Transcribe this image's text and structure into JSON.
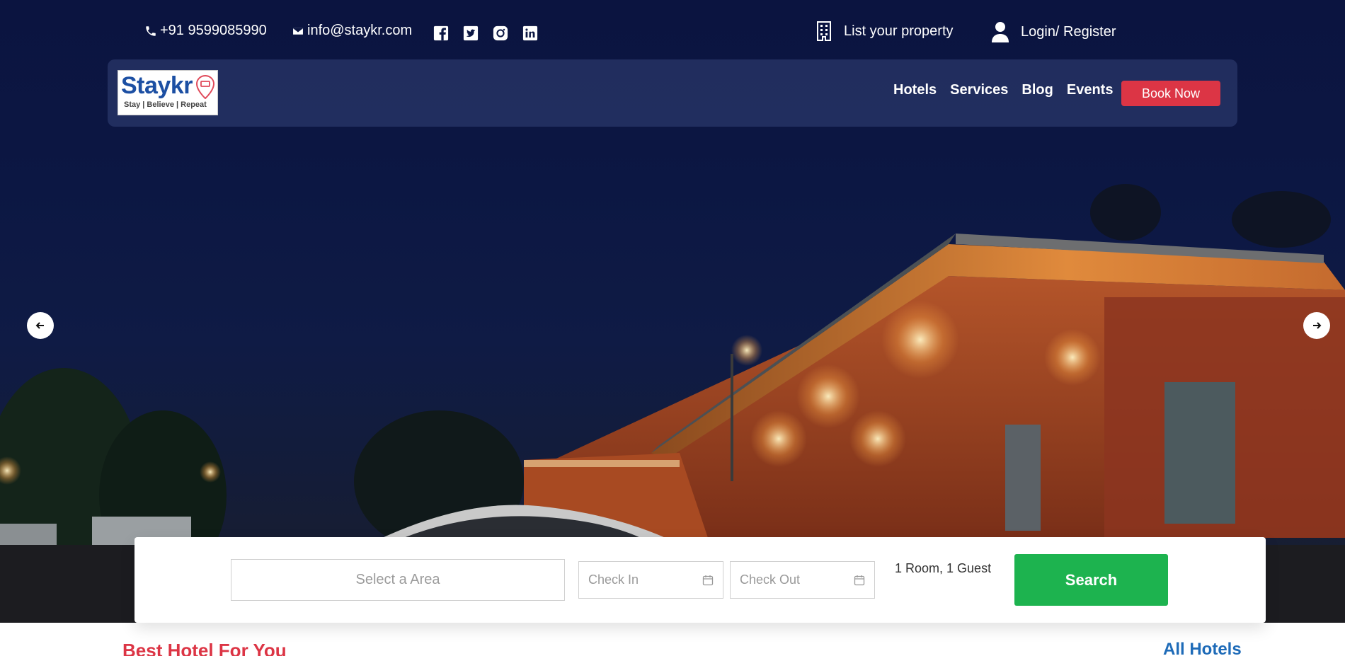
{
  "topbar": {
    "phone": "+91 9599085990",
    "email": "info@staykr.com",
    "social_icons": [
      "facebook-icon",
      "twitter-icon",
      "instagram-icon",
      "linkedin-icon"
    ],
    "list_property_label": "List your property",
    "login_label": "Login/ Register"
  },
  "nav": {
    "logo": {
      "word": "Staykr",
      "tagline": "Stay | Believe | Repeat"
    },
    "links": [
      "Hotels",
      "Services",
      "Blog",
      "Events"
    ],
    "book_now_label": "Book Now"
  },
  "search": {
    "area_placeholder": "Select a Area",
    "check_in_label": "Check In",
    "check_out_label": "Check Out",
    "guests_label": "1 Room, 1 Guest",
    "search_label": "Search"
  },
  "section": {
    "title": "Best Hotel For You",
    "all_hotels_label": "All Hotels"
  },
  "colors": {
    "hero_bg": "#0c1743",
    "accent_red": "#dc3545",
    "search_green": "#1db34f",
    "link_blue": "#1e6bb8"
  }
}
